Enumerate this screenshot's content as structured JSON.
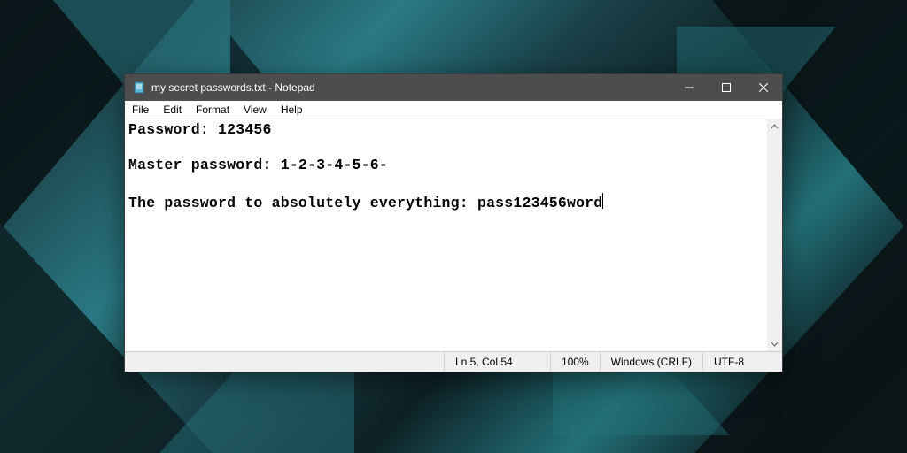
{
  "titlebar": {
    "title": "my secret passwords.txt - Notepad"
  },
  "menu": {
    "items": [
      "File",
      "Edit",
      "Format",
      "View",
      "Help"
    ]
  },
  "document": {
    "line1": "Password: 123456",
    "line2": "",
    "line3": "Master password: 1-2-3-4-5-6-",
    "line4": "",
    "line5": "The password to absolutely everything: pass123456word"
  },
  "statusbar": {
    "position": "Ln 5, Col 54",
    "zoom": "100%",
    "line_ending": "Windows (CRLF)",
    "encoding": "UTF-8"
  },
  "colors": {
    "titlebar_bg": "#4d4d4d",
    "desktop_teal_dark": "#0d2125",
    "desktop_teal_mid": "#237078",
    "desktop_teal_light": "#2a7a85"
  }
}
